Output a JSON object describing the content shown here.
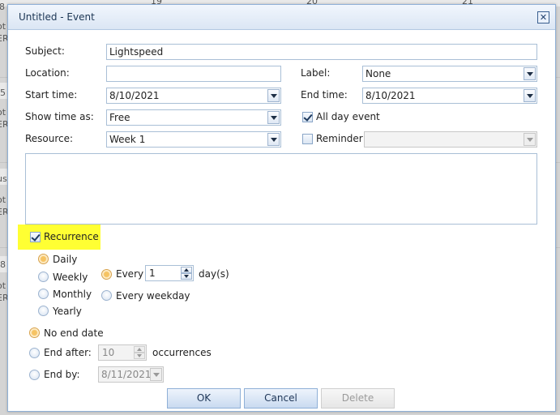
{
  "background": {
    "header_numbers": [
      "19",
      "20",
      "21"
    ],
    "left_fragments": [
      "8",
      "ot",
      "ER",
      "5",
      "ot",
      "ER",
      "us",
      "ot",
      "ER",
      "8",
      "ot",
      "ER"
    ]
  },
  "dialog": {
    "title": "Untitled - Event",
    "close_glyph": "✕"
  },
  "form": {
    "subject_label": "Subject:",
    "subject_value": "Lightspeed",
    "location_label": "Location:",
    "location_value": "",
    "label_label": "Label:",
    "label_value": "None",
    "start_label": "Start time:",
    "start_value": "8/10/2021",
    "end_label": "End time:",
    "end_value": "8/10/2021",
    "showas_label": "Show time as:",
    "showas_value": "Free",
    "allday_label": "All day event",
    "allday_checked": true,
    "resource_label": "Resource:",
    "resource_value": "Week 1",
    "reminder_label": "Reminder",
    "reminder_checked": false,
    "reminder_value": "",
    "description": ""
  },
  "recurrence": {
    "label": "Recurrence",
    "checked": true,
    "highlight_color": "#ffff33",
    "patterns": [
      "Daily",
      "Weekly",
      "Monthly",
      "Yearly"
    ],
    "selected_pattern": "Daily",
    "every_label": "Every",
    "every_value": "1",
    "days_suffix": "day(s)",
    "every_weekday_label": "Every weekday",
    "selected_daily_option": "Every",
    "range": {
      "no_end_label": "No end date",
      "end_after_label": "End after:",
      "end_after_value": "10",
      "occurrences_label": "occurrences",
      "end_by_label": "End by:",
      "end_by_value": "8/11/2021",
      "selected": "No end date"
    }
  },
  "buttons": {
    "ok": "OK",
    "cancel": "Cancel",
    "delete": "Delete",
    "delete_enabled": false
  },
  "colors": {
    "titlebar": "#dbe6f4",
    "border": "#8fb0d7",
    "radio_selected": "#f6c363"
  }
}
